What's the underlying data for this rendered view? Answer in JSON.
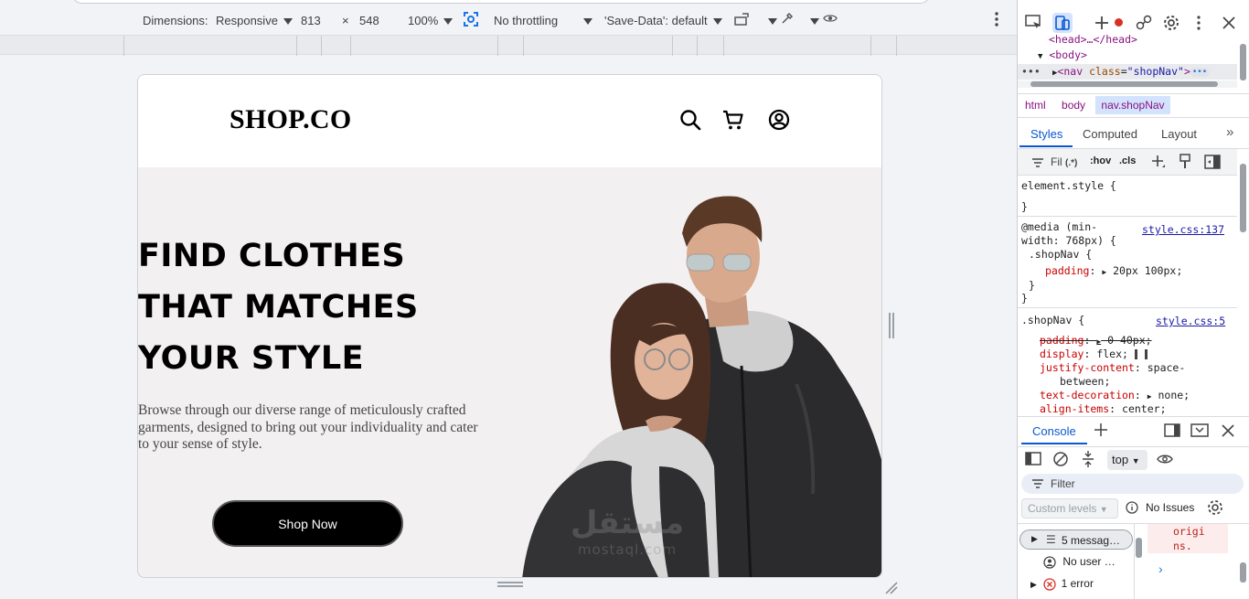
{
  "device_toolbar": {
    "dimensions_label": "Dimensions:",
    "device": "Responsive",
    "width": "813",
    "times": "×",
    "height": "548",
    "zoom": "100%",
    "throttling": "No throttling",
    "save_data": "'Save-Data': default"
  },
  "shop": {
    "logo": "SHOP.CO",
    "headline_lines": [
      "FIND CLOTHES",
      "THAT MATCHES",
      "YOUR STYLE"
    ],
    "description": "Browse through our diverse range of meticulously crafted garments, designed to bring out your individuality and cater to your sense of style.",
    "cta": "Shop Now"
  },
  "watermark": {
    "arabic": "مستقل",
    "latin": "mostaql.com"
  },
  "devtools": {
    "dom": {
      "line1": "<head>…</head>",
      "line2_open": "<",
      "line2_tag": "body",
      "line2_close": ">",
      "line3_tag": "nav",
      "line3_attr": "class",
      "line3_val": "\"shopNav\""
    },
    "breadcrumb": [
      "html",
      "body",
      "nav.shopNav"
    ],
    "tabs": [
      "Styles",
      "Computed",
      "Layout"
    ],
    "filter_label": "Fil",
    "filter_regex": "(.*)",
    "hov": ":hov",
    "cls": ".cls",
    "element_style": "element.style {",
    "close_brace": "}",
    "media_rule": {
      "query_line1": "@media (min-",
      "query_line2": "width: 768px) {",
      "source": "style.css:137",
      "selector": ".shopNav {",
      "prop": "padding",
      "value": "20px 100px;"
    },
    "base_rule": {
      "selector": ".shopNav {",
      "source": "style.css:5",
      "decls": [
        {
          "prop": "padding",
          "value": "0 40px;",
          "struck": true
        },
        {
          "prop": "display",
          "value": "flex;",
          "struck": false
        },
        {
          "prop": "justify-content",
          "value": "space-",
          "struck": false
        },
        {
          "prop": "",
          "value": "between;",
          "struck": false
        },
        {
          "prop": "text-decoration",
          "value": "none;",
          "struck": false
        },
        {
          "prop": "align-items",
          "value": "center;",
          "struck": false
        }
      ]
    },
    "console": {
      "tab": "Console",
      "context": "top",
      "filter_placeholder": "Filter",
      "levels": "Custom levels",
      "issues": "No Issues",
      "sidebar_items": [
        {
          "label": "5 messag…",
          "icon": "list-icon"
        },
        {
          "label": "No user …",
          "icon": "user-icon"
        },
        {
          "label": "1 error",
          "icon": "error-icon"
        }
      ],
      "message_lines": [
        "origi",
        "ns."
      ]
    }
  },
  "colors": {
    "accent": "#0b57d0",
    "record_red": "#d93025",
    "page_bg": "#f2f0f1",
    "cta_bg": "#000000"
  }
}
